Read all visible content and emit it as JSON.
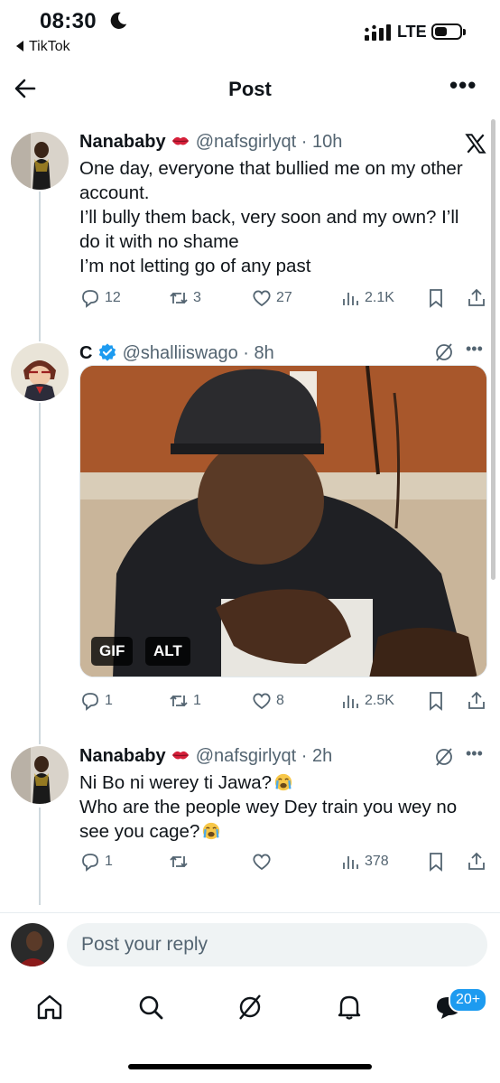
{
  "status_bar": {
    "time": "08:30",
    "back_app": "TikTok",
    "network": "LTE"
  },
  "header": {
    "title": "Post"
  },
  "posts": [
    {
      "name": "Nanababy",
      "handle": "@nafsgirlyqt",
      "time": "10h",
      "text_lines": [
        "One day, everyone that bullied me on my other",
        "account.",
        "I’ll bully them back, very soon and my own? I’ll",
        "do it with no shame",
        "I’m not letting go of any past"
      ],
      "stats": {
        "replies": "12",
        "reposts": "3",
        "likes": "27",
        "views": "2.1K"
      }
    },
    {
      "name": "C",
      "handle": "@shalliiswago",
      "time": "8h",
      "media_badges": [
        "GIF",
        "ALT"
      ],
      "stats": {
        "replies": "1",
        "reposts": "1",
        "likes": "8",
        "views": "2.5K"
      }
    },
    {
      "name": "Nanababy",
      "handle": "@nafsgirlyqt",
      "time": "2h",
      "text_lines": [
        "Ni Bo ni werey ti Jawa?",
        "Who are the people wey Dey train you wey no",
        "see you cage?"
      ],
      "stats": {
        "replies": "1",
        "reposts": "",
        "likes": "",
        "views": "378"
      }
    }
  ],
  "reply_bar": {
    "placeholder": "Post your reply"
  },
  "tabbar": {
    "notifications_badge": "20+"
  },
  "colors": {
    "accent": "#1d9bf0",
    "muted": "#536471",
    "text": "#0f1419",
    "verified": "#1d9bf0"
  }
}
